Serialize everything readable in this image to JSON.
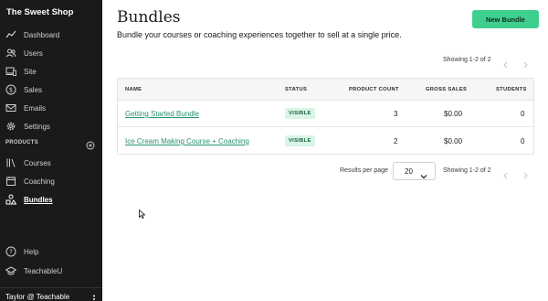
{
  "sidebar": {
    "brand": "The Sweet Shop",
    "items": [
      {
        "label": "Dashboard",
        "icon": "chart-line-icon"
      },
      {
        "label": "Users",
        "icon": "users-icon"
      },
      {
        "label": "Site",
        "icon": "devices-icon"
      },
      {
        "label": "Sales",
        "icon": "dollar-icon"
      },
      {
        "label": "Emails",
        "icon": "envelope-icon"
      },
      {
        "label": "Settings",
        "icon": "gear-icon"
      }
    ],
    "products_header": "PRODUCTS",
    "products": [
      {
        "label": "Courses",
        "icon": "books-icon"
      },
      {
        "label": "Coaching",
        "icon": "calendar-icon"
      },
      {
        "label": "Bundles",
        "icon": "shapes-icon",
        "active": true
      }
    ],
    "bottom": [
      {
        "label": "Help",
        "icon": "question-icon"
      },
      {
        "label": "TeachableU",
        "icon": "graduation-cap-icon"
      }
    ],
    "user": "Taylor @ Teachable"
  },
  "page": {
    "title": "Bundles",
    "subtitle": "Bundle your courses or coaching experiences together to sell at a single price.",
    "new_button": "New Bundle"
  },
  "pagination": {
    "top_text": "Showing 1-2 of 2",
    "bottom_text": "Showing 1-2 of 2",
    "results_per_page_label": "Results per page",
    "results_per_page_value": "20"
  },
  "table": {
    "columns": [
      "NAME",
      "STATUS",
      "PRODUCT COUNT",
      "GROSS SALES",
      "STUDENTS"
    ],
    "rows": [
      {
        "name": "Getting Started Bundle",
        "status": "VISIBLE",
        "product_count": "3",
        "gross_sales": "$0.00",
        "students": "0"
      },
      {
        "name": "Ice Cream Making Course + Coaching",
        "status": "VISIBLE",
        "product_count": "2",
        "gross_sales": "$0.00",
        "students": "0"
      }
    ]
  },
  "colors": {
    "sidebar_bg": "#1a1a1a",
    "accent": "#3ecf8e",
    "link": "#26946a",
    "badge_bg": "#d8f5e6"
  }
}
